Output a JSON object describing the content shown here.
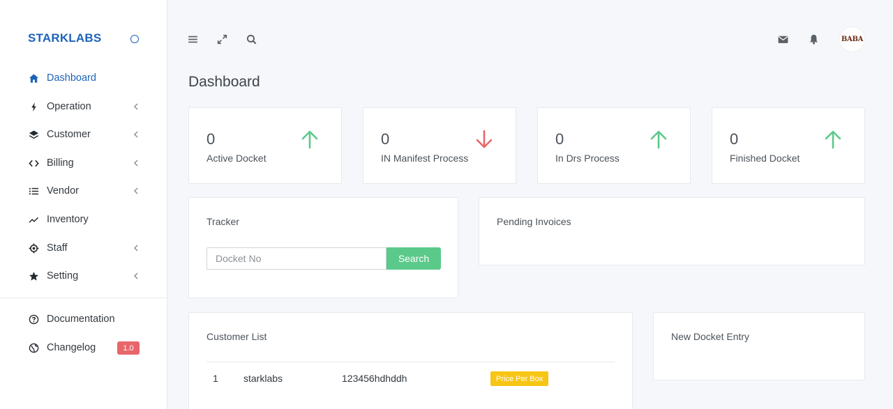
{
  "sidebar": {
    "brand": "STARKLABS",
    "items": [
      {
        "label": "Dashboard",
        "icon": "home-icon"
      },
      {
        "label": "Operation",
        "icon": "bolt-icon"
      },
      {
        "label": "Customer",
        "icon": "layers-icon"
      },
      {
        "label": "Billing",
        "icon": "code-icon"
      },
      {
        "label": "Vendor",
        "icon": "list-icon"
      },
      {
        "label": "Inventory",
        "icon": "trend-icon"
      },
      {
        "label": "Staff",
        "icon": "crosshair-icon"
      },
      {
        "label": "Setting",
        "icon": "star-icon"
      }
    ],
    "footer": [
      {
        "label": "Documentation",
        "icon": "help-circle-icon"
      },
      {
        "label": "Changelog",
        "icon": "globe-icon",
        "badge": "1.0"
      }
    ]
  },
  "topbar": {
    "avatar_text": "BABA"
  },
  "page": {
    "title": "Dashboard"
  },
  "stats": [
    {
      "value": "0",
      "label": "Active Docket",
      "trend": "up",
      "color": "#5bc98a"
    },
    {
      "value": "0",
      "label": "IN Manifest Process",
      "trend": "down",
      "color": "#e8666a"
    },
    {
      "value": "0",
      "label": "In Drs Process",
      "trend": "up",
      "color": "#5bc98a"
    },
    {
      "value": "0",
      "label": "Finished Docket",
      "trend": "up",
      "color": "#5bc98a"
    }
  ],
  "tracker": {
    "title": "Tracker",
    "placeholder": "Docket No",
    "button": "Search"
  },
  "pending_invoices": {
    "title": "Pending Invoices"
  },
  "customer_list": {
    "title": "Customer List",
    "rows": [
      {
        "index": "1",
        "name": "starklabs",
        "code": "123456hdhddh",
        "tag": "Price Per Box"
      }
    ]
  },
  "new_docket": {
    "title": "New Docket Entry"
  },
  "colors": {
    "accent": "#1c63b8",
    "success": "#5bc98a",
    "danger": "#e8666a",
    "warning": "#f7c515"
  }
}
